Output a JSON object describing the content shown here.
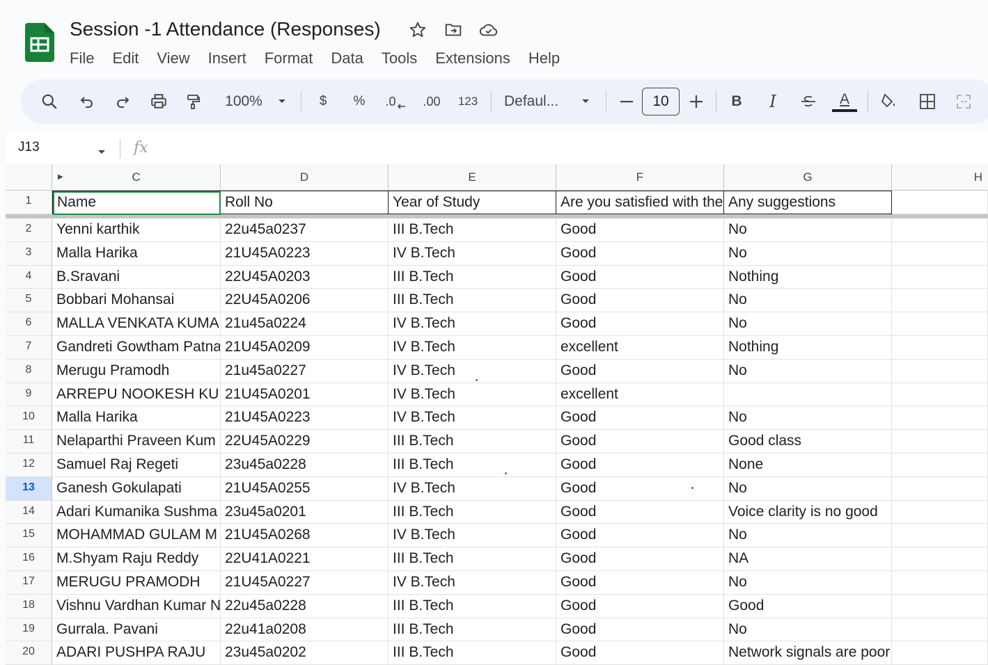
{
  "app": {
    "title": "Session -1 Attendance  (Responses)",
    "menu": [
      "File",
      "Edit",
      "View",
      "Insert",
      "Format",
      "Data",
      "Tools",
      "Extensions",
      "Help"
    ],
    "accent_color": "#188038"
  },
  "toolbar": {
    "zoom": "100%",
    "currency": "$",
    "percent": "%",
    "decrease_decimal": ".0",
    "increase_decimal": ".00",
    "number_format": "123",
    "font": "Defaul...",
    "font_size": "10",
    "bold": "B",
    "italic": "I",
    "text_color": "A"
  },
  "formula_bar": {
    "name_box": "J13",
    "fx": "fx",
    "value": ""
  },
  "sheet": {
    "columns": [
      "C",
      "D",
      "E",
      "F",
      "G",
      "H"
    ],
    "selected_row": "13",
    "rows": [
      {
        "num": "1",
        "cells": [
          "Name",
          "Roll No",
          "Year of Study",
          "Are you satisfied with the",
          "Any suggestions"
        ]
      },
      {
        "num": "2",
        "cells": [
          "Yenni karthik",
          "22u45a0237",
          "III B.Tech",
          "Good",
          "No"
        ]
      },
      {
        "num": "3",
        "cells": [
          "Malla Harika",
          "21U45A0223",
          "IV B.Tech",
          "Good",
          "No"
        ]
      },
      {
        "num": "4",
        "cells": [
          "B.Sravani",
          "22U45A0203",
          "III B.Tech",
          "Good",
          "Nothing"
        ]
      },
      {
        "num": "5",
        "cells": [
          "Bobbari Mohansai",
          "22U45A0206",
          "III B.Tech",
          "Good",
          "No"
        ]
      },
      {
        "num": "6",
        "cells": [
          "MALLA VENKATA KUMA",
          "21u45a0224",
          "IV B.Tech",
          "Good",
          "No"
        ]
      },
      {
        "num": "7",
        "cells": [
          "Gandreti Gowtham Patna",
          "21U45A0209",
          "IV B.Tech",
          "excellent",
          "Nothing"
        ]
      },
      {
        "num": "8",
        "cells": [
          "Merugu Pramodh",
          "21u45a0227",
          "IV B.Tech",
          "Good",
          "No"
        ]
      },
      {
        "num": "9",
        "cells": [
          "ARREPU NOOKESH KU",
          "21U45A0201",
          "IV B.Tech",
          "excellent",
          ""
        ]
      },
      {
        "num": "10",
        "cells": [
          "Malla Harika",
          "21U45A0223",
          "IV B.Tech",
          "Good",
          "No"
        ]
      },
      {
        "num": "11",
        "cells": [
          "Nelaparthi Praveen Kum",
          "22U45A0229",
          "III B.Tech",
          "Good",
          "Good class"
        ]
      },
      {
        "num": "12",
        "cells": [
          "Samuel Raj Regeti",
          "23u45a0228",
          "III B.Tech",
          "Good",
          "None"
        ]
      },
      {
        "num": "13",
        "cells": [
          "Ganesh Gokulapati",
          "21U45A0255",
          "IV B.Tech",
          "Good",
          "No"
        ]
      },
      {
        "num": "14",
        "cells": [
          "Adari Kumanika Sushma",
          "23u45a0201",
          "III B.Tech",
          "Good",
          "Voice clarity is no good"
        ]
      },
      {
        "num": "15",
        "cells": [
          "MOHAMMAD GULAM M",
          "21U45A0268",
          "IV B.Tech",
          "Good",
          "No"
        ]
      },
      {
        "num": "16",
        "cells": [
          "M.Shyam Raju Reddy",
          "22U41A0221",
          "III B.Tech",
          "Good",
          "NA"
        ]
      },
      {
        "num": "17",
        "cells": [
          "MERUGU PRAMODH",
          "21U45A0227",
          "IV B.Tech",
          "Good",
          "No"
        ]
      },
      {
        "num": "18",
        "cells": [
          "Vishnu Vardhan Kumar N",
          "22u45a0228",
          "III B.Tech",
          "Good",
          "Good"
        ]
      },
      {
        "num": "19",
        "cells": [
          "Gurrala. Pavani",
          "22u41a0208",
          "III B.Tech",
          "Good",
          "No"
        ]
      },
      {
        "num": "20",
        "cells": [
          "ADARI PUSHPA RAJU",
          "23u45a0202",
          "III B.Tech",
          "Good",
          "Network signals are poor"
        ]
      }
    ]
  }
}
